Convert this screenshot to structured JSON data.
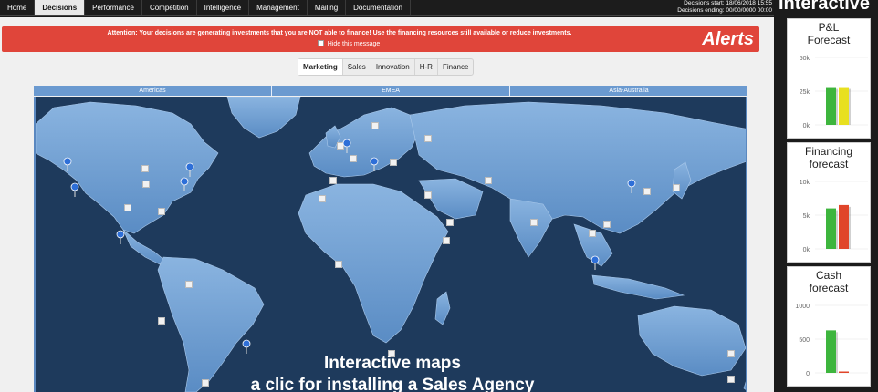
{
  "nav": {
    "tabs": [
      {
        "label": "Home",
        "active": false
      },
      {
        "label": "Decisions",
        "active": true
      },
      {
        "label": "Performance",
        "active": false
      },
      {
        "label": "Competition",
        "active": false
      },
      {
        "label": "Intelligence",
        "active": false
      },
      {
        "label": "Management",
        "active": false
      },
      {
        "label": "Mailing",
        "active": false
      },
      {
        "label": "Documentation",
        "active": false
      }
    ],
    "decisions_start": "Decisions start: 18/06/2018 15:55",
    "decisions_ending": "Decisions ending: 00/00/0000 00:00"
  },
  "alert": {
    "message": "Attention: Your decisions are generating investments that you are NOT able to finance! Use the financing resources still available or reduce investments.",
    "hide_label": "Hide this message",
    "title": "Alerts",
    "color": "#e0453a"
  },
  "subtabs": [
    {
      "label": "Marketing",
      "active": true
    },
    {
      "label": "Sales",
      "active": false
    },
    {
      "label": "Innovation",
      "active": false
    },
    {
      "label": "H-R",
      "active": false
    },
    {
      "label": "Finance",
      "active": false
    }
  ],
  "regions": [
    "Americas",
    "EMEA",
    "Asia-Australia"
  ],
  "map": {
    "caption_line1": "Interactive maps",
    "caption_line2": "a clic for installing a Sales Agency",
    "ocean_color": "#1e3a5c",
    "land_color": "#6e9fd2"
  },
  "right_panel": {
    "title": "Interactive"
  },
  "chart_data": [
    {
      "type": "bar",
      "title": "P&L\nForecast",
      "ticks": [
        "50k",
        "25k",
        "0k"
      ],
      "ylim": [
        0,
        50000
      ],
      "series": [
        {
          "values": [
            28000
          ],
          "color": "#3db53d"
        },
        {
          "values": [
            28000
          ],
          "color": "#e8e020"
        }
      ]
    },
    {
      "type": "bar",
      "title": "Financing\nforecast",
      "ticks": [
        "10k",
        "5k",
        "0k"
      ],
      "ylim": [
        0,
        10000
      ],
      "series": [
        {
          "values": [
            6000
          ],
          "color": "#3db53d"
        },
        {
          "values": [
            6500
          ],
          "color": "#e0452a"
        }
      ]
    },
    {
      "type": "bar",
      "title": "Cash\nforecast",
      "ticks": [
        "1000",
        "500",
        "0"
      ],
      "ylim": [
        0,
        1000
      ],
      "series": [
        {
          "values": [
            630
          ],
          "color": "#3db53d"
        },
        {
          "values": [
            10
          ],
          "color": "#e0452a"
        }
      ]
    }
  ]
}
